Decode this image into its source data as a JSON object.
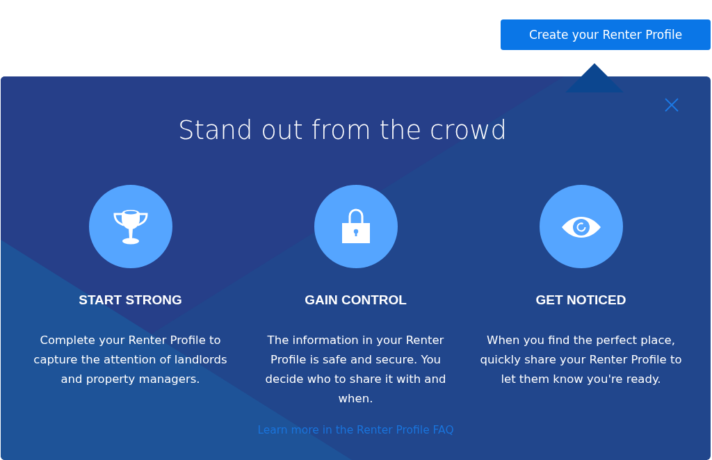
{
  "header_button": {
    "label": "Create your Renter Profile"
  },
  "panel": {
    "title": "Stand out from the crowd",
    "features": [
      {
        "kind": "trophy",
        "heading": "START STRONG",
        "description": "Complete your Renter Profile to capture the attention of landlords and property managers."
      },
      {
        "kind": "lock",
        "heading": "GAIN CONTROL",
        "description": "The information in your Renter Profile is safe and secure. You decide who to share it with and when."
      },
      {
        "kind": "eye",
        "heading": "GET NOTICED",
        "description": "When you find the perfect place, quickly share your Renter Profile to let them know you're ready."
      }
    ],
    "link": "Learn more in the Renter Profile FAQ"
  }
}
